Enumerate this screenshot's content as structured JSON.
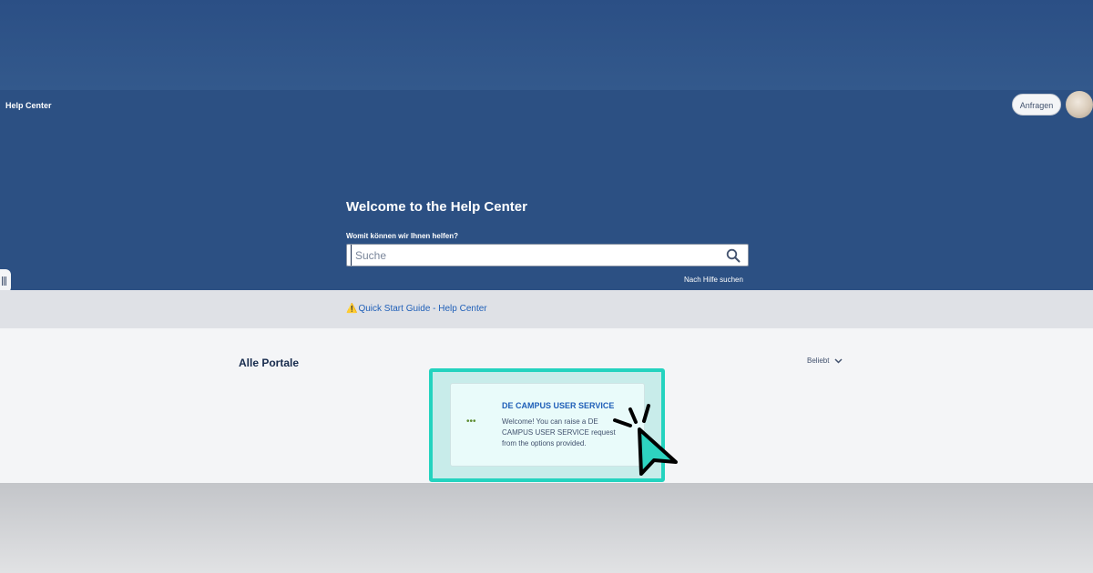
{
  "header": {
    "brand": "Help Center",
    "requests_label": "Anfragen"
  },
  "hero": {
    "title": "Welcome to the Help Center",
    "search_label": "Womit können wir Ihnen helfen?",
    "search_placeholder": "Suche",
    "search_value": "",
    "help_link": "Nach Hilfe suchen"
  },
  "notice": {
    "icon": "warning-icon",
    "link": "Quick Start Guide - Help Center"
  },
  "portals": {
    "title": "Alle Portale",
    "sort_label": "Beliebt",
    "items": [
      {
        "name": "DE CAMPUS USER SERVICE",
        "description": "Welcome! You can raise a DE CAMPUS USER SERVICE request from the options provided."
      }
    ]
  },
  "colors": {
    "header_bg": "#2c5083",
    "highlight": "#24d3bf",
    "link": "#1f5fb8"
  }
}
